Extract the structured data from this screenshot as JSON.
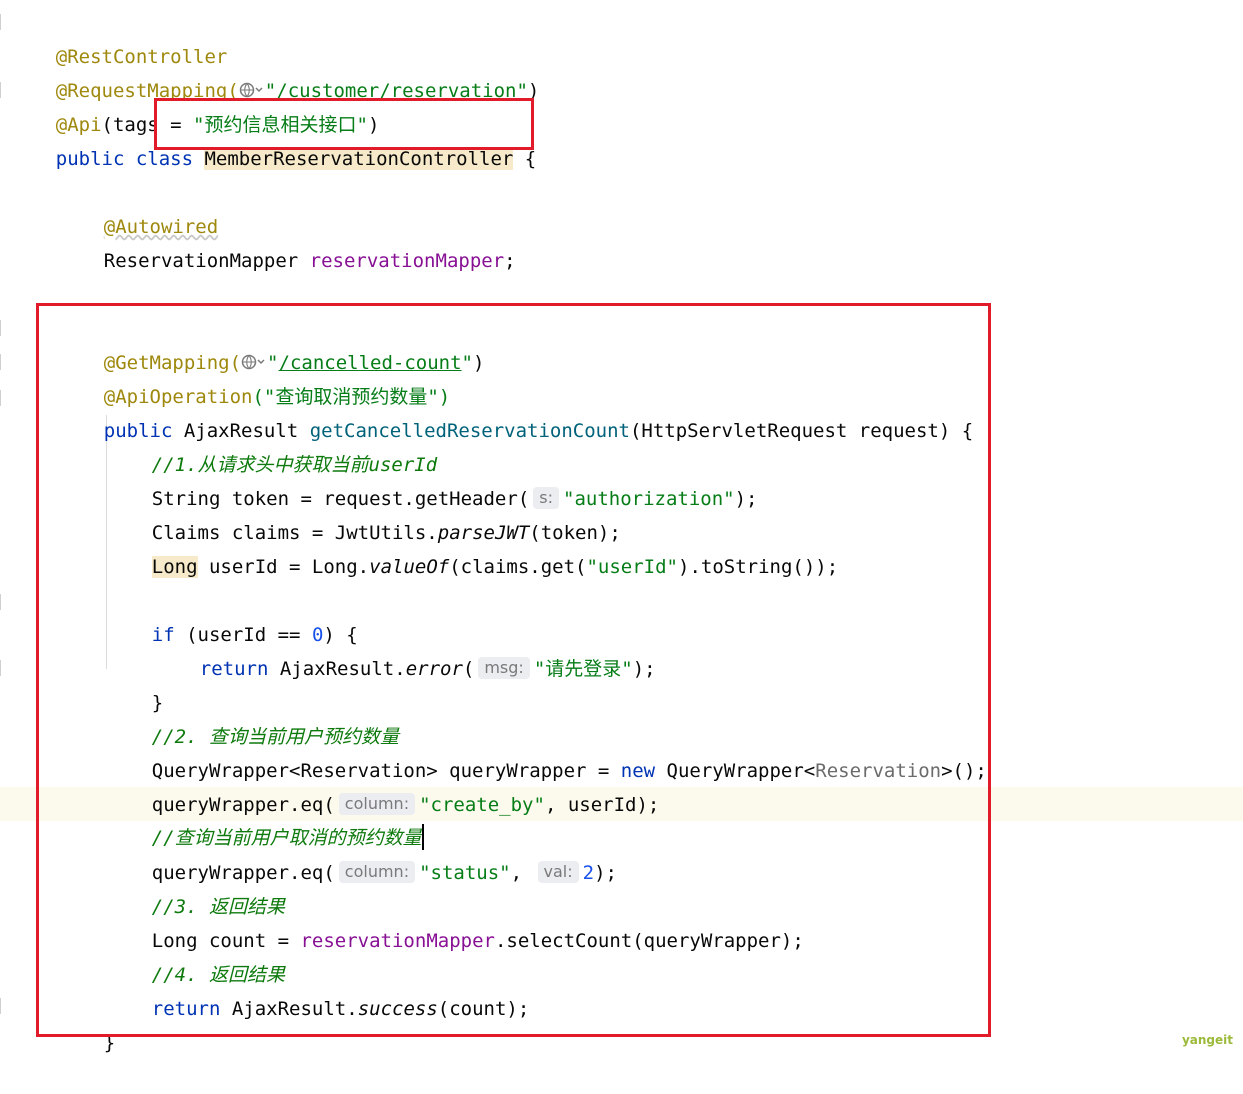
{
  "code": {
    "l1_ann": "@RestController",
    "l2_ann": "@RequestMapping(",
    "l2_path": "/customer/reservation",
    "l3_ann": "@Api",
    "l3_rest": "(tags = ",
    "l3_str": "\"预约信息相关接口\"",
    "l4_kw": "public class ",
    "l4_class": "MemberReservationController",
    "l4_brace": " {",
    "l6_ann": "@Autowired",
    "l7_type": "ReservationMapper ",
    "l7_field": "reservationMapper",
    "l10_ann": "@GetMapping(",
    "l10_path": "/cancelled-count",
    "l11_ann": "@ApiOperation",
    "l11_str": "(\"查询取消预约数量\")",
    "l12_kw": "public",
    "l12_type": " AjaxResult ",
    "l12_method": "getCancelledReservationCount",
    "l12_params": "(HttpServletRequest request) {",
    "l13_cmt": "//1.从请求头中获取当前userId",
    "l14_a": "String token = request.getHeader(",
    "l14_hint": "s:",
    "l14_str": "\"authorization\"",
    "l14_end": ");",
    "l15_a": "Claims claims = JwtUtils.",
    "l15_m": "parseJWT",
    "l15_end": "(token);",
    "l16_long": "Long",
    "l16_a": " userId = Long.",
    "l16_m": "valueOf",
    "l16_b": "(claims.get(",
    "l16_str": "\"userId\"",
    "l16_end": ").toString());",
    "l18_kw": "if",
    "l18_a": " (userId == ",
    "l18_num": "0",
    "l18_end": ") {",
    "l19_kw": "return",
    "l19_a": " AjaxResult.",
    "l19_m": "error",
    "l19_b": "(",
    "l19_hint": "msg:",
    "l19_str": "\"请先登录\"",
    "l19_end": ");",
    "l20": "}",
    "l21_cmt": "//2. 查询当前用户预约数量",
    "l22_a": "QueryWrapper<Reservation> queryWrapper = ",
    "l22_kw": "new",
    "l22_b": " QueryWrapper<",
    "l22_tp": "Reservation",
    "l22_end": ">();",
    "l23_a": "queryWrapper.eq(",
    "l23_hint": "column:",
    "l23_str": "\"create_by\"",
    "l23_end": ", userId);",
    "l24_cmt": "//查询当前用户取消的预约数量",
    "l25_a": "queryWrapper.eq(",
    "l25_hint1": "column:",
    "l25_str": "\"status\"",
    "l25_mid": ",",
    "l25_hint2": "val:",
    "l25_num": "2",
    "l25_end": ");",
    "l26_cmt": "//3. 返回结果",
    "l27_a": "Long count = ",
    "l27_field": "reservationMapper",
    "l27_end": ".selectCount(queryWrapper);",
    "l28_cmt": "//4. 返回结果",
    "l29_kw": "return",
    "l29_a": " AjaxResult.",
    "l29_m": "success",
    "l29_end": "(count);",
    "l30": "}"
  },
  "watermark": "yangeit",
  "colors": {
    "keyword": "#0033b3",
    "annotation": "#9e880d",
    "string": "#067d17",
    "field": "#871094",
    "method": "#00627a",
    "comment": "#0e7a0d",
    "highlight_box": "#e21b2a"
  }
}
